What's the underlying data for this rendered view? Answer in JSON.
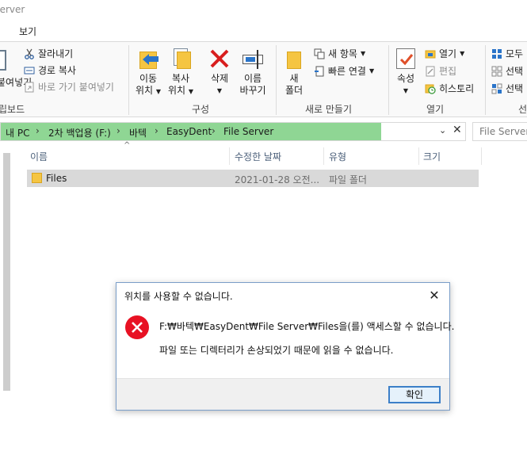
{
  "window": {
    "title": "Server"
  },
  "ribbon": {
    "tab_view": "보기",
    "clipboard": {
      "label": "립보드",
      "paste_partial": "붙여넣기",
      "cut": "잘라내기",
      "copy_path": "경로 복사",
      "paste_shortcut": "바로 가기 붙여넣기"
    },
    "organize": {
      "label": "구성",
      "move_to_line1": "이동",
      "move_to_line2": "위치",
      "copy_to_line1": "복사",
      "copy_to_line2": "위치",
      "delete": "삭제",
      "rename_line1": "이름",
      "rename_line2": "바꾸기"
    },
    "new": {
      "label": "새로 만들기",
      "new_folder_line1": "새",
      "new_folder_line2": "폴더",
      "new_item": "새 항목",
      "easy_access": "빠른 연결"
    },
    "open": {
      "label": "열기",
      "properties": "속성",
      "open": "열기",
      "edit": "편집",
      "history": "히스토리"
    },
    "select": {
      "label": "선",
      "select_all": "모두",
      "select_none": "선택",
      "invert": "선택"
    }
  },
  "address": {
    "crumbs": [
      "내 PC",
      "2차 백업용 (F:)",
      "바텍",
      "EasyDent",
      "File Server"
    ],
    "search_placeholder": "File Server"
  },
  "list": {
    "columns": [
      "이름",
      "수정한 날짜",
      "유형",
      "크기"
    ],
    "rows": [
      {
        "name": "Files",
        "date": "2021-01-28 오전...",
        "type": "파일 폴더",
        "size": ""
      }
    ]
  },
  "dialog": {
    "title": "위치를 사용할 수 없습니다.",
    "message1": "F:₩바텍₩EasyDent₩File Server₩Files을(를) 액세스할 수 없습니다.",
    "message2": "파일 또는 디렉터리가 손상되었기 때문에 읽을 수 없습니다.",
    "ok": "확인"
  },
  "colors": {
    "address_fill": "#8fd694",
    "selected_row": "#d9d9d9",
    "error_red": "#e81123",
    "accent": "#3c7fc8"
  }
}
